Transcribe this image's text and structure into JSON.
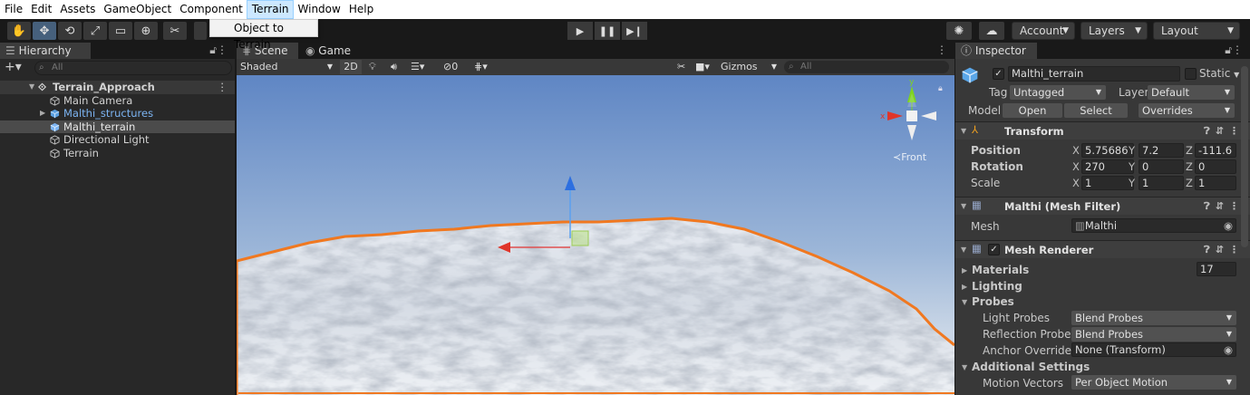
{
  "menu": {
    "items": [
      "File",
      "Edit",
      "Assets",
      "GameObject",
      "Component",
      "Terrain",
      "Window",
      "Help"
    ],
    "active": "Terrain",
    "terrain_dropdown": [
      "Object to Terrain"
    ]
  },
  "toolbar": {
    "account_label": "Account",
    "layers_label": "Layers",
    "layout_label": "Layout"
  },
  "hierarchy": {
    "tab_label": "Hierarchy",
    "search_placeholder": "All",
    "root": "Terrain_Approach",
    "items": [
      {
        "label": "Main Camera"
      },
      {
        "label": "Malthi_structures"
      },
      {
        "label": "Malthi_terrain"
      },
      {
        "label": "Directional Light"
      },
      {
        "label": "Terrain"
      }
    ]
  },
  "scene": {
    "tab_scene": "Scene",
    "tab_game": "Game",
    "shading": "Shaded",
    "mode_2d": "2D",
    "hidden_count": "0",
    "gizmos_label": "Gizmos",
    "search_placeholder": "All",
    "view_label": "Front"
  },
  "inspector": {
    "tab_label": "Inspector",
    "object_name": "Malthi_terrain",
    "static_label": "Static",
    "tag_label": "Tag",
    "tag_value": "Untagged",
    "layer_label": "Layer",
    "layer_value": "Default",
    "model_label": "Model",
    "open_label": "Open",
    "select_label": "Select",
    "overrides_label": "Overrides",
    "transform": {
      "title": "Transform",
      "position_label": "Position",
      "rotation_label": "Rotation",
      "scale_label": "Scale",
      "position": {
        "x": "5.75686",
        "y": "7.2",
        "z": "-111.6"
      },
      "rotation": {
        "x": "270",
        "y": "0",
        "z": "0"
      },
      "scale": {
        "x": "1",
        "y": "1",
        "z": "1"
      }
    },
    "mesh_filter": {
      "title": "Malthi (Mesh Filter)",
      "mesh_label": "Mesh",
      "mesh_value": "Malthi"
    },
    "mesh_renderer": {
      "title": "Mesh Renderer",
      "materials_label": "Materials",
      "materials_count": "17",
      "lighting_label": "Lighting",
      "probes_label": "Probes",
      "light_probes_label": "Light Probes",
      "light_probes_value": "Blend Probes",
      "reflection_probes_label": "Reflection Probes",
      "reflection_probes_value": "Blend Probes",
      "anchor_override_label": "Anchor Override",
      "anchor_override_value": "None (Transform)",
      "additional_settings_label": "Additional Settings",
      "motion_vectors_label": "Motion Vectors",
      "motion_vectors_value": "Per Object Motion"
    }
  },
  "colors": {
    "selection_outline": "#f07820",
    "sky_top": "#5f86c4",
    "sky_horizon": "#c9d6e6",
    "axis_x": "#e0352a",
    "axis_y": "#7ed321",
    "axis_z": "#2d6fe0"
  }
}
